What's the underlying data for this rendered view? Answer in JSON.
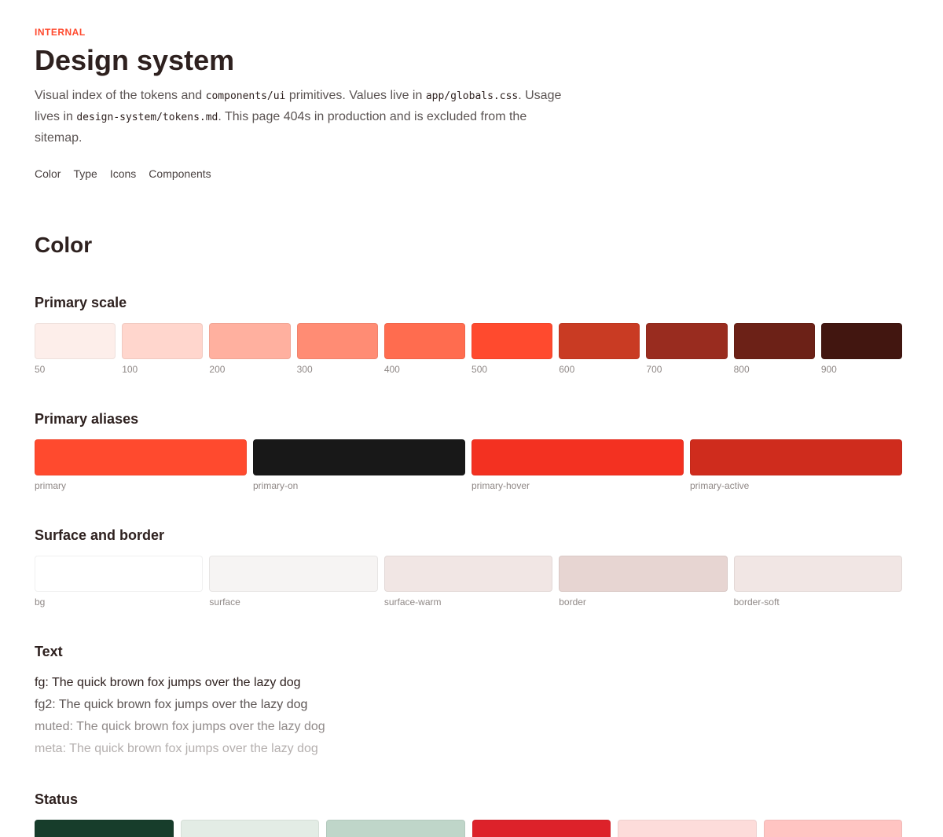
{
  "header": {
    "eyebrow": "INTERNAL",
    "title": "Design system",
    "intro": {
      "t1": "Visual index of the tokens and ",
      "c1": "components/ui",
      "t2": " primitives. Values live in ",
      "c2": "app/globals.css",
      "t3": ". Usage lives in ",
      "c3": "design-system/tokens.md",
      "t4": ". This page 404s in production and is excluded from the sitemap."
    }
  },
  "nav": [
    "Color",
    "Type",
    "Icons",
    "Components"
  ],
  "color": {
    "heading": "Color",
    "primary_scale": {
      "heading": "Primary scale",
      "swatches": [
        {
          "label": "50",
          "color": "#fdeeea"
        },
        {
          "label": "100",
          "color": "#ffd6cd"
        },
        {
          "label": "200",
          "color": "#ffb09f"
        },
        {
          "label": "300",
          "color": "#ff8c74"
        },
        {
          "label": "400",
          "color": "#ff6c4f"
        },
        {
          "label": "500",
          "color": "#ff4a2e"
        },
        {
          "label": "600",
          "color": "#c93b23"
        },
        {
          "label": "700",
          "color": "#992c1f"
        },
        {
          "label": "800",
          "color": "#6c2117"
        },
        {
          "label": "900",
          "color": "#421610"
        }
      ]
    },
    "primary_aliases": {
      "heading": "Primary aliases",
      "swatches": [
        {
          "label": "primary",
          "color": "#ff4a2e"
        },
        {
          "label": "primary-on",
          "color": "#181818"
        },
        {
          "label": "primary-hover",
          "color": "#f33121"
        },
        {
          "label": "primary-active",
          "color": "#cf2c1d"
        }
      ]
    },
    "surface_border": {
      "heading": "Surface and border",
      "swatches": [
        {
          "label": "bg",
          "color": "#ffffff"
        },
        {
          "label": "surface",
          "color": "#f6f4f3"
        },
        {
          "label": "surface-warm",
          "color": "#f1e6e4"
        },
        {
          "label": "border",
          "color": "#e7d5d2"
        },
        {
          "label": "border-soft",
          "color": "#f1e6e4"
        }
      ]
    },
    "text": {
      "heading": "Text",
      "samples": [
        {
          "label": "fg: The quick brown fox jumps over the lazy dog",
          "color": "#2e211f"
        },
        {
          "label": "fg2: The quick brown fox jumps over the lazy dog",
          "color": "#5b5453"
        },
        {
          "label": "muted: The quick brown fox jumps over the lazy dog",
          "color": "#908a89"
        },
        {
          "label": "meta: The quick brown fox jumps over the lazy dog",
          "color": "#b4afae"
        }
      ]
    },
    "status": {
      "heading": "Status",
      "swatches": [
        {
          "color": "#173d2b"
        },
        {
          "color": "#e3ece5"
        },
        {
          "color": "#bfd6c9"
        },
        {
          "color": "#dd222a"
        },
        {
          "color": "#fddcda"
        },
        {
          "color": "#ffc4c2"
        }
      ]
    }
  }
}
